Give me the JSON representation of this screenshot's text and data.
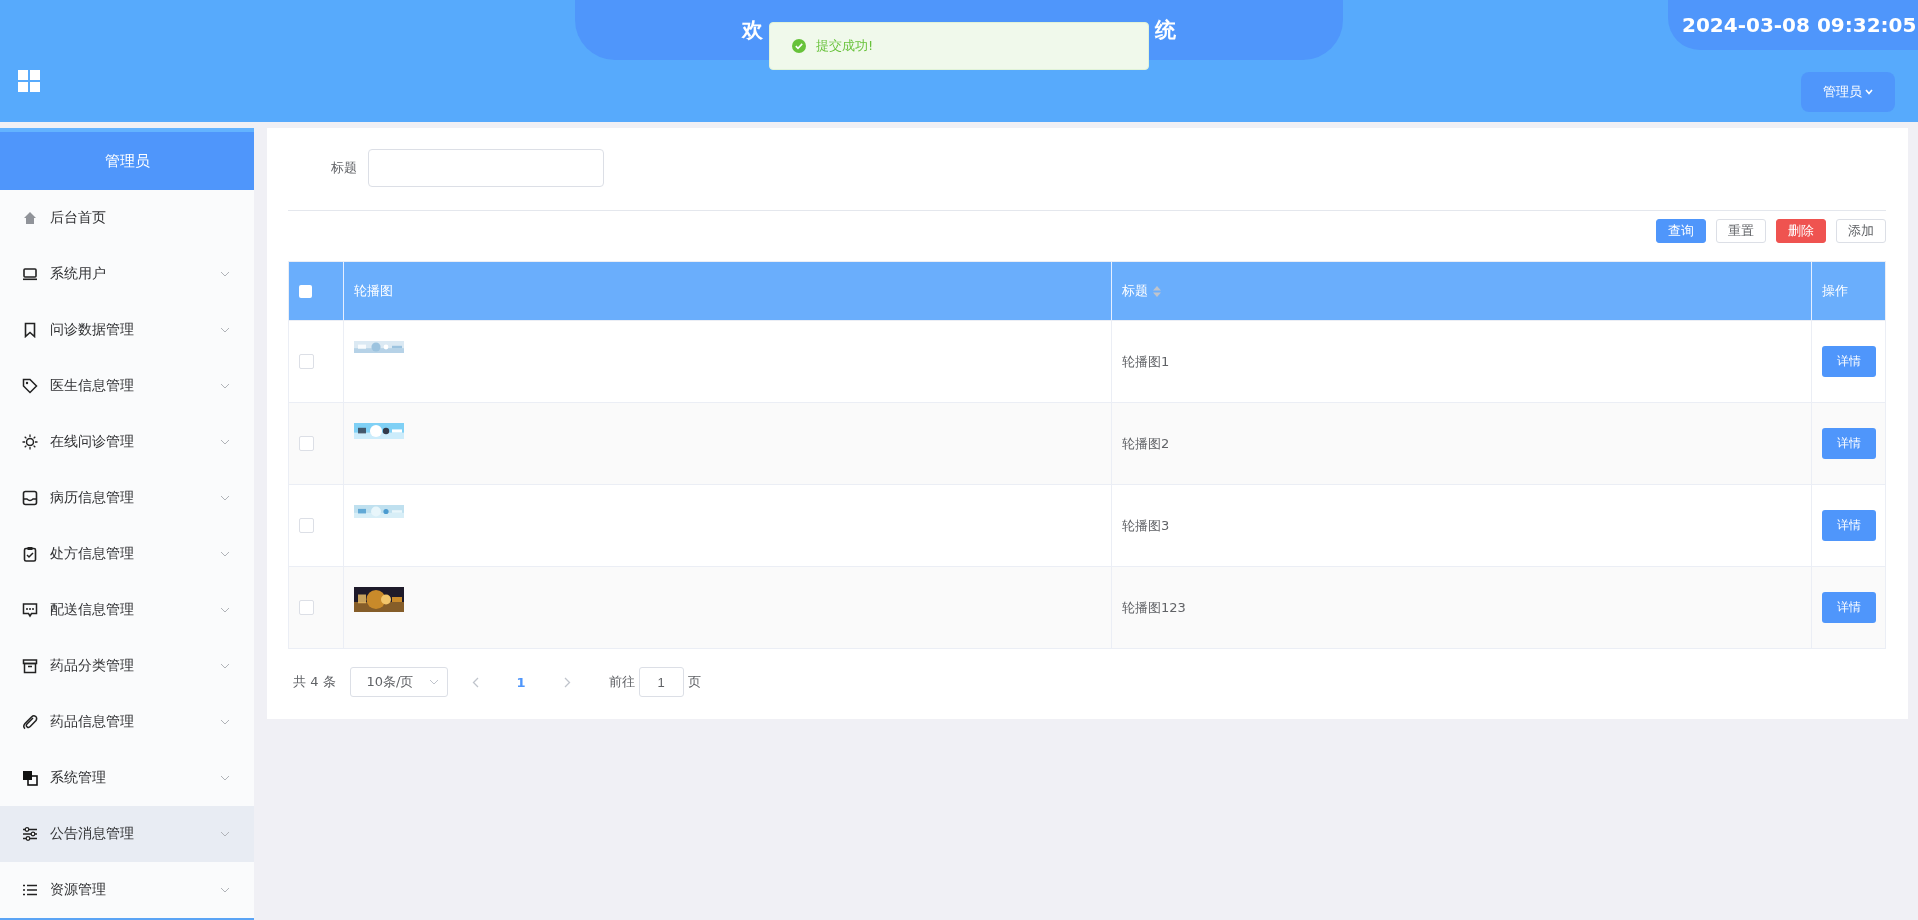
{
  "header": {
    "title_start": "欢",
    "title_end": "统",
    "datetime": "2024-03-08 09:32:05",
    "user_menu": "管理员"
  },
  "toast": {
    "kind": "success",
    "message": "提交成功!"
  },
  "sidebar": {
    "title": "管理员",
    "items": [
      {
        "label": "后台首页",
        "expandable": false,
        "selected": false
      },
      {
        "label": "系统用户",
        "expandable": true,
        "selected": false
      },
      {
        "label": "问诊数据管理",
        "expandable": true,
        "selected": false
      },
      {
        "label": "医生信息管理",
        "expandable": true,
        "selected": false
      },
      {
        "label": "在线问诊管理",
        "expandable": true,
        "selected": false
      },
      {
        "label": "病历信息管理",
        "expandable": true,
        "selected": false
      },
      {
        "label": "处方信息管理",
        "expandable": true,
        "selected": false
      },
      {
        "label": "配送信息管理",
        "expandable": true,
        "selected": false
      },
      {
        "label": "药品分类管理",
        "expandable": true,
        "selected": false
      },
      {
        "label": "药品信息管理",
        "expandable": true,
        "selected": false
      },
      {
        "label": "系统管理",
        "expandable": true,
        "selected": false
      },
      {
        "label": "公告消息管理",
        "expandable": true,
        "selected": true
      },
      {
        "label": "资源管理",
        "expandable": true,
        "selected": false
      }
    ]
  },
  "search": {
    "label": "标题"
  },
  "actions": [
    {
      "label": "查询",
      "kind": "primary"
    },
    {
      "label": "重置",
      "kind": "plain"
    },
    {
      "label": "删除",
      "kind": "danger"
    },
    {
      "label": "添加",
      "kind": "plain"
    }
  ],
  "table": {
    "all_checked": false,
    "columns": [
      "轮播图",
      "标题",
      "操作"
    ],
    "rows": [
      {
        "checked": false,
        "title": "轮播图1",
        "action": "详情"
      },
      {
        "checked": false,
        "title": "轮播图2",
        "action": "详情"
      },
      {
        "checked": false,
        "title": "轮播图3",
        "action": "详情"
      },
      {
        "checked": false,
        "title": "轮播图123",
        "action": "详情"
      }
    ]
  },
  "pagination": {
    "total": "共 4 条",
    "page_size": "10条/页",
    "pages": [
      {
        "label": "1",
        "selected": true
      }
    ],
    "goto_label": "前往",
    "goto_value": "1",
    "goto_suffix": "页"
  }
}
